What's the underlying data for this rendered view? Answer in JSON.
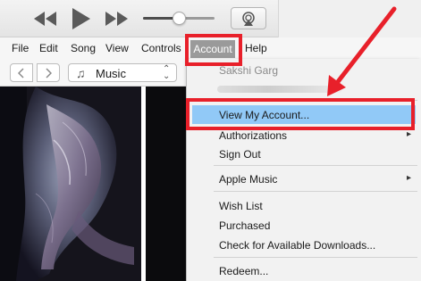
{
  "menubar": {
    "items": [
      "File",
      "Edit",
      "Song",
      "View",
      "Controls",
      "Account",
      "Help"
    ]
  },
  "navigation": {
    "media_selector": "Music"
  },
  "player": {
    "volume_level": 0.5
  },
  "account_menu": {
    "user_name": "Sakshi Garg",
    "items": [
      "View My Account...",
      "Authorizations",
      "Sign Out",
      "Apple Music",
      "Wish List",
      "Purchased",
      "Check for Available Downloads...",
      "Redeem..."
    ],
    "submenu_arrow": "▸",
    "highlighted": "View My Account..."
  },
  "annotations": {
    "color": "#e8202a"
  },
  "icons": {
    "rewind": "rewind-icon",
    "play": "play-icon",
    "fast_forward": "fast-forward-icon",
    "airplay": "airplay-icon",
    "back": "chevron-left-icon",
    "forward": "chevron-right-icon",
    "music_note": "music-note-icon",
    "select": "up-down-chevron-icon"
  }
}
